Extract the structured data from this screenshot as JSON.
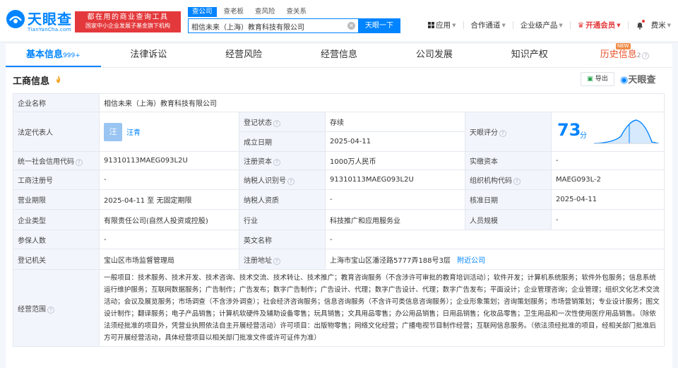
{
  "brand": {
    "logo_text": "天眼查",
    "logo_sub": "TianYanCha.com",
    "slogan_line1": "都在用的商业查询工具",
    "slogan_line2": "国家中小企业发展子基金旗下机构",
    "colors": {
      "primary": "#0084ff",
      "red": "#e4393c"
    }
  },
  "search": {
    "tabs": [
      "查公司",
      "查老板",
      "查风险",
      "查关系"
    ],
    "active_tab": 0,
    "value": "相信未来（上海）教育科技有限公司",
    "button": "天眼一下"
  },
  "nav": {
    "app": "应用",
    "partner": "合作通道",
    "enterprise": "企业级产品",
    "vip": "开通会员",
    "user": "费米"
  },
  "tabs": [
    {
      "label": "基本信息",
      "count": "999+"
    },
    {
      "label": "法律诉讼",
      "count": ""
    },
    {
      "label": "经营风险",
      "count": ""
    },
    {
      "label": "经营信息",
      "count": ""
    },
    {
      "label": "公司发展",
      "count": ""
    },
    {
      "label": "知识产权",
      "count": ""
    },
    {
      "label": "历史信息",
      "count": "2"
    }
  ],
  "history_badge": "NEW",
  "section": {
    "title": "工商信息",
    "export": "导出",
    "watermark": "天眼查"
  },
  "info": {
    "company_name_label": "企业名称",
    "company_name": "相信未来（上海）教育科技有限公司",
    "legal_rep_label": "法定代表人",
    "legal_rep_avatar": "汪",
    "legal_rep": "汪青",
    "reg_status_label": "登记状态",
    "reg_status": "存续",
    "found_date_label": "成立日期",
    "found_date": "2025-04-11",
    "score_label": "天眼评分",
    "score": 73,
    "score_unit": "分",
    "credit_code_label": "统一社会信用代码",
    "credit_code": "91310113MAEG093L2U",
    "reg_capital_label": "注册资本",
    "reg_capital": "1000万人民币",
    "paid_capital_label": "实缴资本",
    "paid_capital": "-",
    "reg_no_label": "工商注册号",
    "reg_no": "-",
    "taxpayer_id_label": "纳税人识别号",
    "taxpayer_id": "91310113MAEG093L2U",
    "org_code_label": "组织机构代码",
    "org_code": "MAEG093L-2",
    "term_label": "营业期限",
    "term": "2025-04-11 至 无固定期限",
    "taxpayer_qual_label": "纳税人资质",
    "taxpayer_qual": "-",
    "approval_date_label": "核准日期",
    "approval_date": "2025-04-11",
    "type_label": "企业类型",
    "type": "有限责任公司(自然人投资或控股)",
    "industry_label": "行业",
    "industry": "科技推广和应用服务业",
    "staff_label": "人员规模",
    "staff": "-",
    "insured_label": "参保人数",
    "insured": "-",
    "english_name_label": "英文名称",
    "english_name": "-",
    "authority_label": "登记机关",
    "authority": "宝山区市场监督管理局",
    "address_label": "注册地址",
    "address": "上海市宝山区潘泾路5777弄188号3层",
    "nearby": "附近公司",
    "scope_label": "经营范围",
    "scope": "一般项目：技术服务、技术开发、技术咨询、技术交流、技术转让、技术推广；教育咨询服务（不含涉许可审批的教育培训活动）；软件开发；计算机系统服务；软件外包服务；信息系统运行维护服务；互联网数据服务；广告制作；广告发布；数字广告制作；广告设计、代理；数字广告设计、代理；数字广告发布；平面设计；企业管理咨询；企业管理；组织文化艺术交流活动；会议及展览服务；市场调查（不含涉外调查）；社会经济咨询服务；信息咨询服务（不含许可类信息咨询服务）；企业形象策划；咨询策划服务；市场营销策划；专业设计服务；图文设计制作；翻译服务；电子产品销售；计算机软硬件及辅助设备零售；玩具销售；文具用品零售；办公用品销售；日用品销售；化妆品零售；卫生用品和一次性使用医疗用品销售。（除依法须经批准的项目外，凭营业执照依法自主开展经营活动）许可项目：出版物零售；网络文化经营；广播电视节目制作经营；互联网信息服务。（依法须经批准的项目，经相关部门批准后方可开展经营活动，具体经营项目以相关部门批准文件或许可证件为准）"
  }
}
